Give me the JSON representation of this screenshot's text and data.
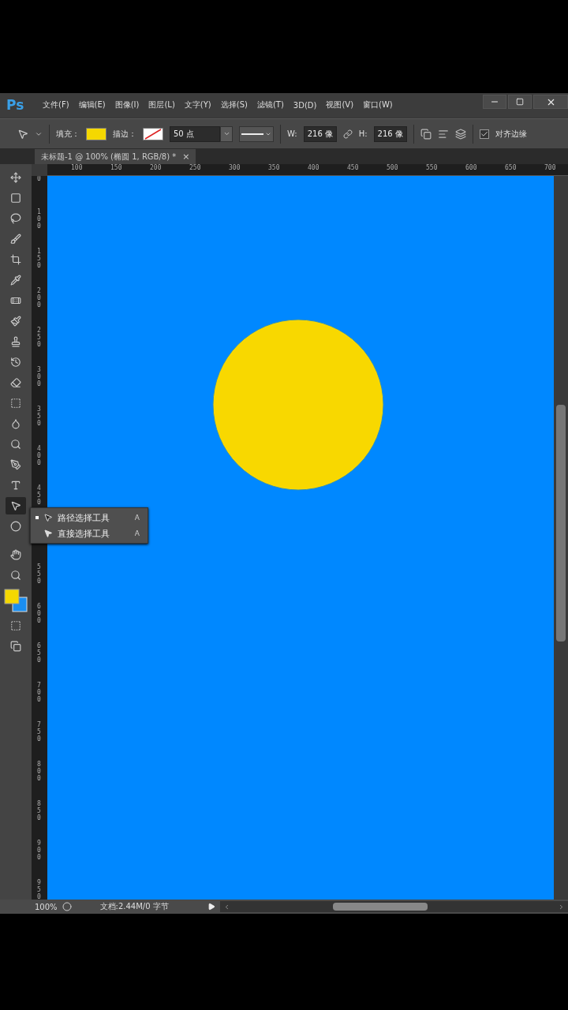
{
  "app_logo": "Ps",
  "menu": [
    "文件(F)",
    "编辑(E)",
    "图像(I)",
    "图层(L)",
    "文字(Y)",
    "选择(S)",
    "滤镜(T)",
    "3D(D)",
    "视图(V)",
    "窗口(W)"
  ],
  "options": {
    "fill_label": "填充：",
    "stroke_label": "描边：",
    "stroke_width": "50 点",
    "w_label": "W:",
    "w_value": "216 像",
    "h_label": "H:",
    "h_value": "216 像",
    "align_edges": {
      "label": "对齐边缘",
      "checked": true
    }
  },
  "tab": {
    "title": "未标题-1 @ 100% (椭圆 1, RGB/8) *",
    "close": "×"
  },
  "ruler_h": [
    "100",
    "150",
    "200",
    "250",
    "300",
    "350",
    "400",
    "450",
    "500",
    "550",
    "600",
    "650",
    "700"
  ],
  "ruler_v": [
    "0",
    "100",
    "150",
    "200",
    "250",
    "300",
    "350",
    "400",
    "450",
    "550",
    "600",
    "650",
    "700",
    "750",
    "800",
    "850",
    "900",
    "950"
  ],
  "tools": [
    {
      "selected": false
    },
    {
      "selected": false
    },
    {
      "selected": false
    },
    {
      "selected": false
    },
    {
      "selected": false
    },
    {
      "selected": false
    },
    {
      "selected": false
    },
    {
      "selected": false
    },
    {
      "selected": false
    },
    {
      "selected": false
    },
    {
      "selected": false
    },
    {
      "selected": false
    },
    {
      "selected": false
    },
    {
      "selected": false
    },
    {
      "selected": false
    },
    {
      "selected": false
    },
    {
      "selected": true
    },
    {
      "selected": false
    },
    {
      "selected": false
    },
    {
      "selected": false
    }
  ],
  "flyout": [
    {
      "label": "路径选择工具",
      "shortcut": "A",
      "selected": true
    },
    {
      "label": "直接选择工具",
      "shortcut": "A",
      "selected": false
    }
  ],
  "status": {
    "zoom": "100%",
    "doc": "文档:2.44M/0 字节"
  }
}
